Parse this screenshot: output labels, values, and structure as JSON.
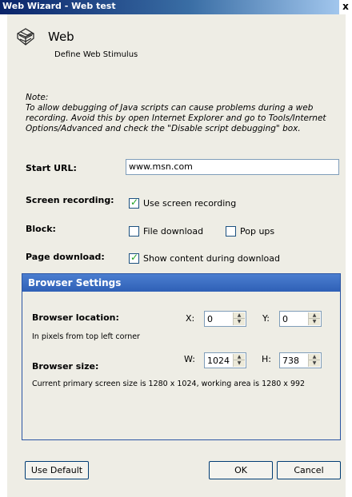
{
  "window": {
    "title": "Web Wizard - Web test",
    "close_glyph": "x"
  },
  "header": {
    "title": "Web",
    "subtitle": "Define Web Stimulus",
    "icon": "web-globe-icon"
  },
  "note": {
    "heading": "Note:",
    "text": "To allow debugging of Java scripts can cause problems during a web recording. Avoid this by open Internet Explorer and go to Tools/Internet Options/Advanced and check the \"Disable script debugging\" box."
  },
  "start_url": {
    "label": "Start URL:",
    "value": "www.msn.com"
  },
  "screen_recording": {
    "label": "Screen recording:",
    "option": "Use screen recording",
    "checked": true
  },
  "block": {
    "label": "Block:",
    "file_download": {
      "label": "File download",
      "checked": false
    },
    "pop_ups": {
      "label": "Pop ups",
      "checked": false
    }
  },
  "page_download": {
    "label": "Page download:",
    "option": "Show content during download",
    "checked": true
  },
  "browser_settings": {
    "title": "Browser Settings",
    "location_label": "Browser location:",
    "location_hint": "In pixels from top left corner",
    "x_label": "X:",
    "x_value": "0",
    "y_label": "Y:",
    "y_value": "0",
    "size_label": "Browser size:",
    "w_label": "W:",
    "w_value": "1024",
    "h_label": "H:",
    "h_value": "738",
    "screen_info": "Current primary screen size is 1280 x 1024, working area is 1280 x 992"
  },
  "buttons": {
    "use_default": "Use Default",
    "ok": "OK",
    "cancel": "Cancel"
  },
  "colors": {
    "titlebar": "#0a246a",
    "group_header": "#3a6cc3",
    "dialog_bg": "#eeede5",
    "check_mark": "#21a121"
  }
}
